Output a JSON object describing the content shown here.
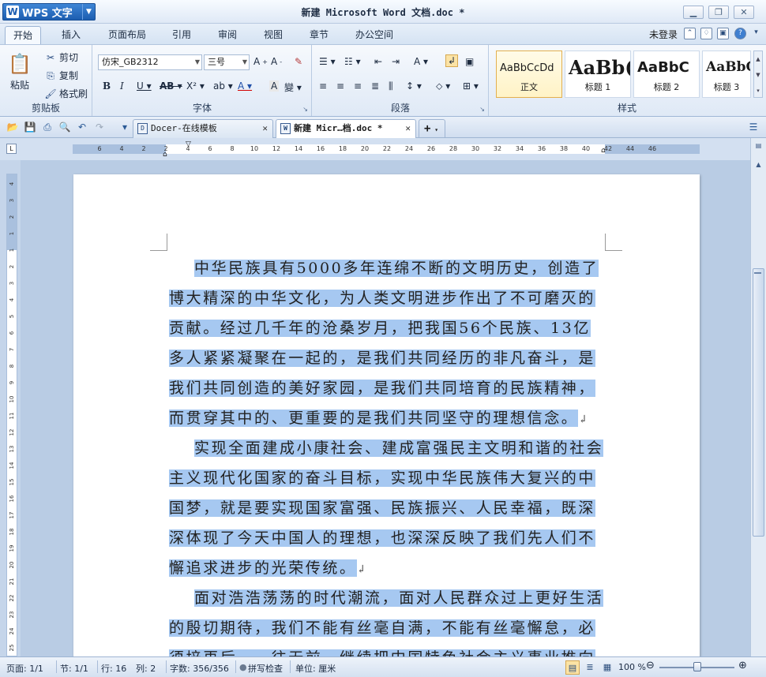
{
  "app": {
    "name": "WPS 文字",
    "window_title": "新建 Microsoft Word 文档.doc *",
    "controls": {
      "minimize": "▁",
      "restore": "❐",
      "close": "✕"
    }
  },
  "menu": {
    "tabs": [
      "开始",
      "插入",
      "页面布局",
      "引用",
      "审阅",
      "视图",
      "章节",
      "办公空间"
    ],
    "active": "开始",
    "login": "未登录"
  },
  "ribbon": {
    "clipboard": {
      "label": "剪贴板",
      "paste": "粘贴",
      "cut": "剪切",
      "copy": "复制",
      "format_painter": "格式刷"
    },
    "font": {
      "label": "字体",
      "font_name": "仿宋_GB2312",
      "font_size": "三号"
    },
    "paragraph": {
      "label": "段落"
    },
    "styles": {
      "label": "样式",
      "items": [
        {
          "sample": "AaBbCcDd",
          "name": "正文"
        },
        {
          "sample": "AaBb(",
          "name": "标题 1"
        },
        {
          "sample": "AaBbC",
          "name": "标题 2"
        },
        {
          "sample": "AaBbC",
          "name": "标题 3"
        }
      ]
    }
  },
  "tabs": {
    "documents": [
      {
        "title": "Docer-在线模板",
        "close": "✕"
      },
      {
        "title": "新建 Micr…档.doc *",
        "close": "✕"
      }
    ],
    "new_tab": "+"
  },
  "ruler": {
    "h_ticks": [
      "6",
      "4",
      "2",
      "2",
      "4",
      "6",
      "8",
      "10",
      "12",
      "14",
      "16",
      "18",
      "20",
      "22",
      "24",
      "26",
      "28",
      "30",
      "32",
      "34",
      "36",
      "38",
      "40",
      "42",
      "44",
      "46"
    ],
    "v_ticks": [
      "4",
      "3",
      "2",
      "1",
      "1",
      "2",
      "3",
      "4",
      "5",
      "6",
      "7",
      "8",
      "9",
      "10",
      "11",
      "12",
      "13",
      "14",
      "15",
      "16",
      "17",
      "18",
      "19",
      "20",
      "21",
      "22",
      "23",
      "24",
      "25"
    ]
  },
  "document": {
    "paragraphs": [
      "中华民族具有5000多年连绵不断的文明历史，创造了博大精深的中华文化，为人类文明进步作出了不可磨灭的贡献。经过几千年的沧桑岁月，把我国56个民族、13亿多人紧紧凝聚在一起的，是我们共同经历的非凡奋斗，是我们共同创造的美好家园，是我们共同培育的民族精神，而贯穿其中的、更重要的是我们共同坚守的理想信念。",
      "实现全面建成小康社会、建成富强民主文明和谐的社会主义现代化国家的奋斗目标，实现中华民族伟大复兴的中国梦，就是要实现国家富强、民族振兴、人民幸福，既深深体现了今天中国人的理想，也深深反映了我们先人们不懈追求进步的光荣传统。",
      "面对浩浩荡荡的时代潮流，面对人民群众过上更好生活的殷切期待，我们不能有丝毫自满，不能有丝毫懈怠，必须培再后，一往无前，继续把中国特色社会主义事业推向前进"
    ],
    "para_mark": "↲"
  },
  "status": {
    "page": "页面: 1/1",
    "section": "节: 1/1",
    "line": "行: 16",
    "column": "列: 2",
    "word_count": "字数: 356/356",
    "spell_check": "拼写检查",
    "unit": "单位: 厘米",
    "zoom": "100 %"
  }
}
